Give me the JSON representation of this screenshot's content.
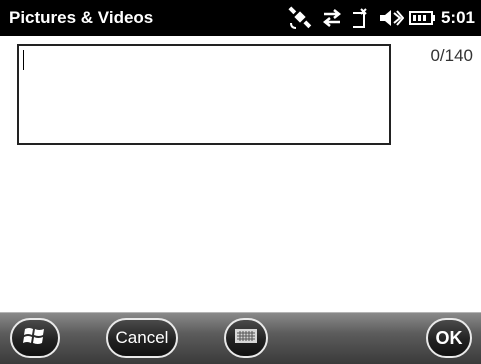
{
  "title_bar": {
    "app_title": "Pictures & Videos",
    "time": "5:01",
    "icons": [
      "gps-satellite-icon",
      "connectivity-arrows-icon",
      "signal-icon",
      "volume-muted-icon",
      "battery-icon"
    ]
  },
  "composer": {
    "text_value": "",
    "char_counter": "0/140"
  },
  "softkeys": {
    "start_icon": "windows-logo-icon",
    "cancel_label": "Cancel",
    "keyboard_icon": "keyboard-icon",
    "ok_label": "OK"
  },
  "colors": {
    "title_bar_bg": "#000000",
    "softkey_bar_bg": "#5c5c5c",
    "button_border": "#e9e9e9"
  }
}
